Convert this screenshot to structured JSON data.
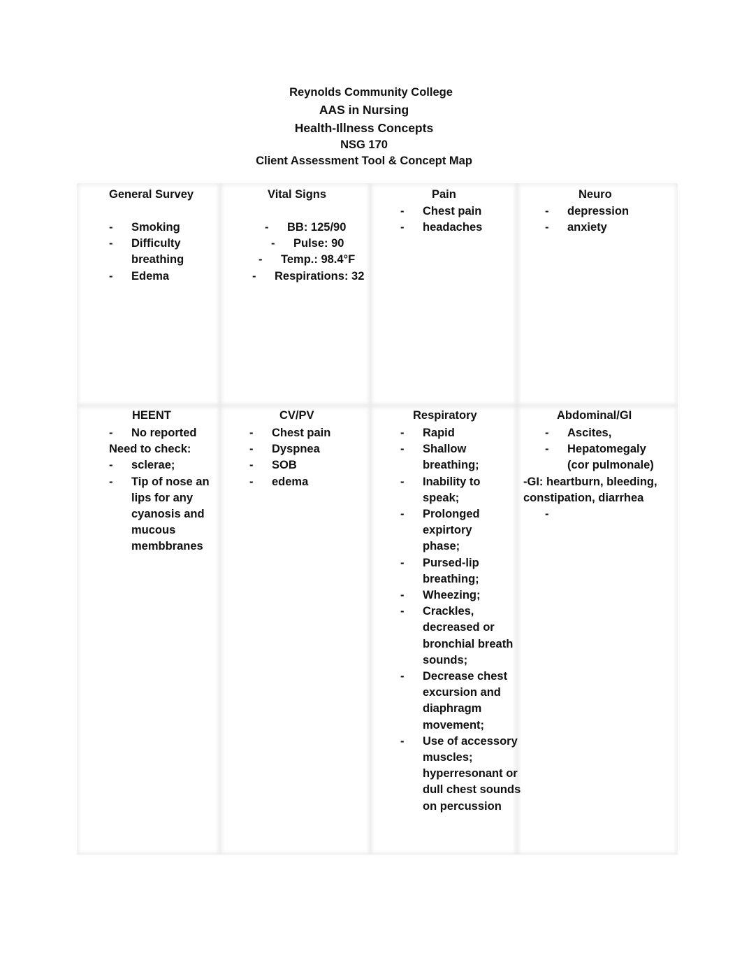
{
  "header": {
    "institution": "Reynolds Community College",
    "program": "AAS in Nursing",
    "course_title": "Health-Illness Concepts",
    "course_code": "NSG 170",
    "document_title": "Client Assessment Tool & Concept Map"
  },
  "bullet": "-",
  "cells": {
    "general_survey": {
      "title": "General Survey",
      "items": [
        "Smoking",
        "Difficulty breathing",
        "Edema"
      ]
    },
    "vital_signs": {
      "title": "Vital Signs",
      "items": [
        "BB: 125/90",
        "Pulse: 90",
        "Temp.: 98.4°F",
        "Respirations: 32"
      ]
    },
    "pain": {
      "title": "Pain",
      "items": [
        "Chest pain",
        "headaches"
      ]
    },
    "neuro": {
      "title": "Neuro",
      "items": [
        "depression",
        "anxiety"
      ]
    },
    "heent": {
      "title": "HEENT",
      "item_0": "No reported",
      "note": "Need to check:",
      "items": [
        "sclerae;",
        "Tip of nose an lips for any cyanosis and mucous membbranes"
      ]
    },
    "cv_pv": {
      "title": "CV/PV",
      "items": [
        "Chest pain",
        "Dyspnea",
        "SOB",
        "edema"
      ]
    },
    "respiratory": {
      "title": "Respiratory",
      "items": [
        "Rapid",
        "Shallow breathing;",
        "Inability to speak;",
        "Prolonged expirtory phase;",
        "Pursed-lip breathing;",
        "Wheezing;",
        "Crackles, decreased or bronchial breath sounds;",
        "Decrease chest excursion and diaphragm movement;",
        "Use of accessory muscles; hyperresonant or dull chest sounds on percussion"
      ]
    },
    "abdominal_gi": {
      "title": "Abdominal/GI",
      "items": [
        "Ascites,",
        "Hepatomegaly (cor pulmonale)"
      ],
      "gi_note": "-GI: heartburn, bleeding, constipation, diarrhea",
      "empty_item": ""
    }
  }
}
